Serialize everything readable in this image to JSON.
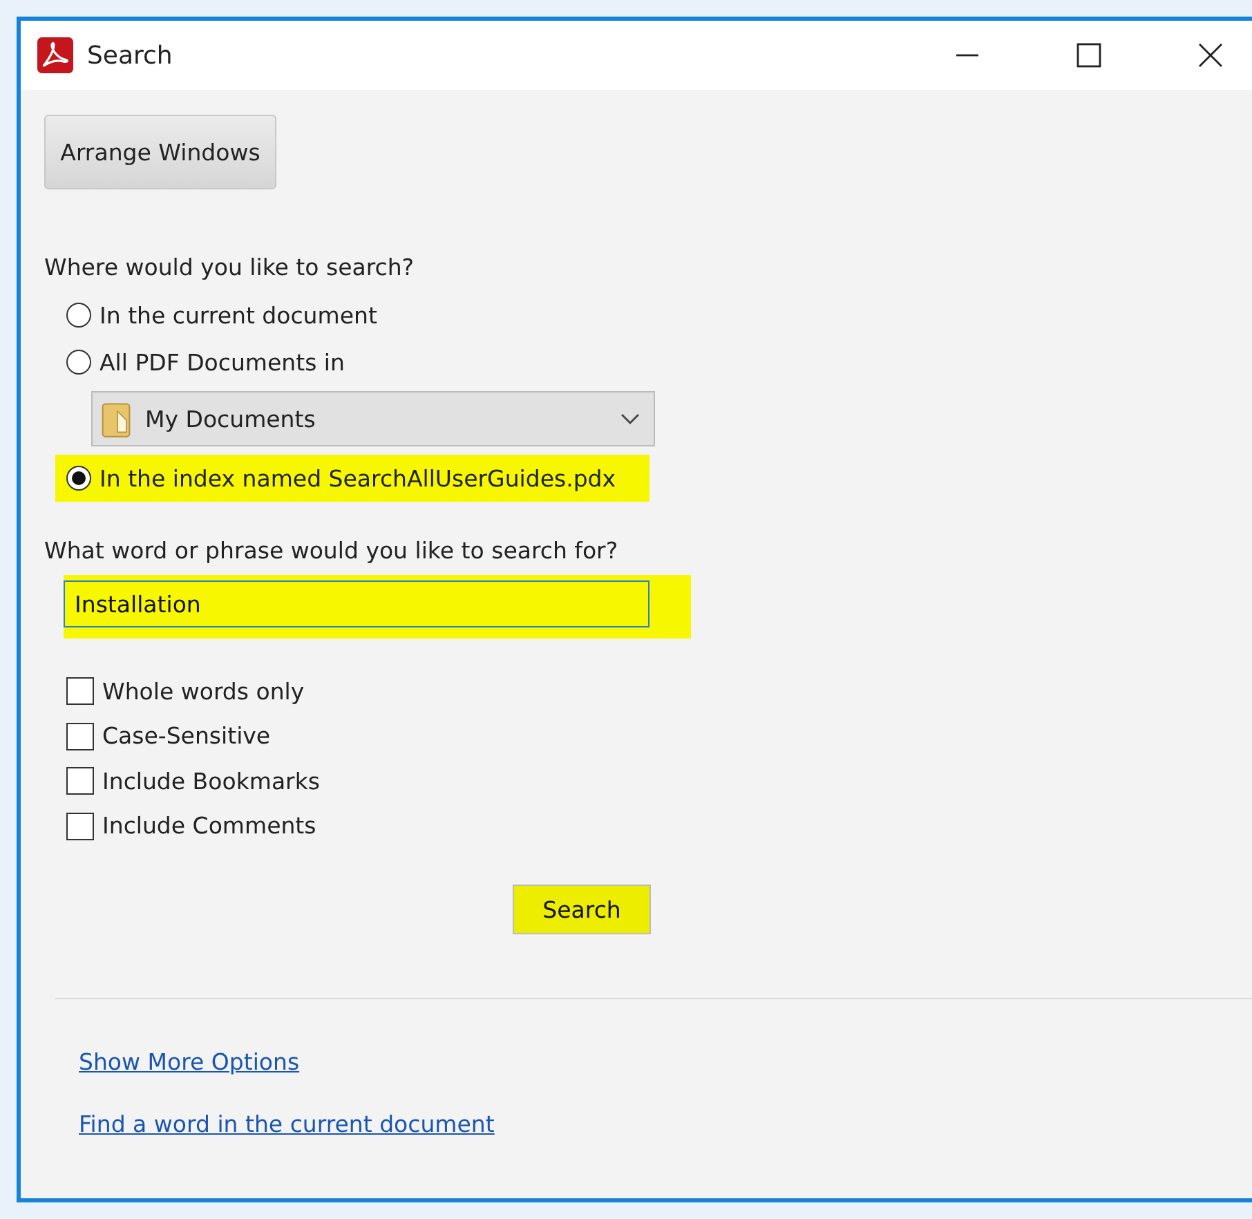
{
  "window": {
    "title": "Search"
  },
  "arrange_button": "Arrange Windows",
  "scope": {
    "question": "Where would you like to search?",
    "items": [
      {
        "kind": "radio",
        "label": "In the current document",
        "selected": false,
        "highlighted": false
      },
      {
        "kind": "radio",
        "label": "All PDF Documents in",
        "selected": false,
        "highlighted": false
      },
      {
        "kind": "dropdown",
        "value": "My Documents"
      },
      {
        "kind": "radio",
        "label": "In the index named SearchAllUserGuides.pdx",
        "selected": true,
        "highlighted": true
      }
    ]
  },
  "query": {
    "question": "What word or phrase would you like to search for?",
    "value": "Installation",
    "highlighted": true
  },
  "options": [
    {
      "label": "Whole words only",
      "checked": false
    },
    {
      "label": "Case-Sensitive",
      "checked": false
    },
    {
      "label": "Include Bookmarks",
      "checked": false
    },
    {
      "label": "Include Comments",
      "checked": false
    }
  ],
  "search_button": {
    "label": "Search",
    "highlighted": true
  },
  "links": [
    "Show More Options",
    "Find a word in the current document"
  ]
}
